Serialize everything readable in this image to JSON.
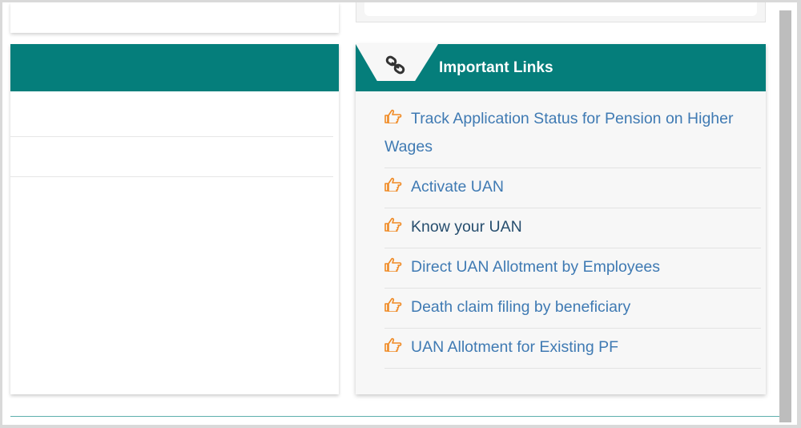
{
  "important_links": {
    "title": "Important Links",
    "items": [
      {
        "label": "Track Application Status for Pension on Higher Wages",
        "style": "link"
      },
      {
        "label": "Activate UAN",
        "style": "link"
      },
      {
        "label": "Know your UAN",
        "style": "visited"
      },
      {
        "label": "Direct UAN Allotment by Employees",
        "style": "link"
      },
      {
        "label": "Death claim filing by beneficiary",
        "style": "link"
      },
      {
        "label": "UAN Allotment for Existing PF",
        "style": "link"
      }
    ]
  },
  "colors": {
    "header_teal": "#057e7b",
    "link_blue": "#3f7ab3",
    "link_visited": "#274e6e",
    "hand_orange": "#f08a24"
  }
}
